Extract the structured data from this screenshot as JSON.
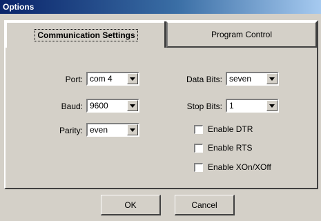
{
  "window": {
    "title": "Options"
  },
  "tabs": [
    {
      "label": "Communication Settings",
      "active": true
    },
    {
      "label": "Program Control",
      "active": false
    }
  ],
  "fields": {
    "port": {
      "label": "Port:",
      "value": "com 4"
    },
    "baud": {
      "label": "Baud:",
      "value": "9600"
    },
    "parity": {
      "label": "Parity:",
      "value": "even"
    },
    "data_bits": {
      "label": "Data Bits:",
      "value": "seven"
    },
    "stop_bits": {
      "label": "Stop Bits:",
      "value": "1"
    }
  },
  "checkboxes": [
    {
      "label": "Enable DTR",
      "checked": false
    },
    {
      "label": "Enable RTS",
      "checked": false
    },
    {
      "label": "Enable XOn/XOff",
      "checked": false
    }
  ],
  "buttons": {
    "ok": "OK",
    "cancel": "Cancel"
  },
  "colors": {
    "face": "#d4d0c8",
    "title_start": "#0a246a",
    "title_end": "#a6caf0"
  }
}
